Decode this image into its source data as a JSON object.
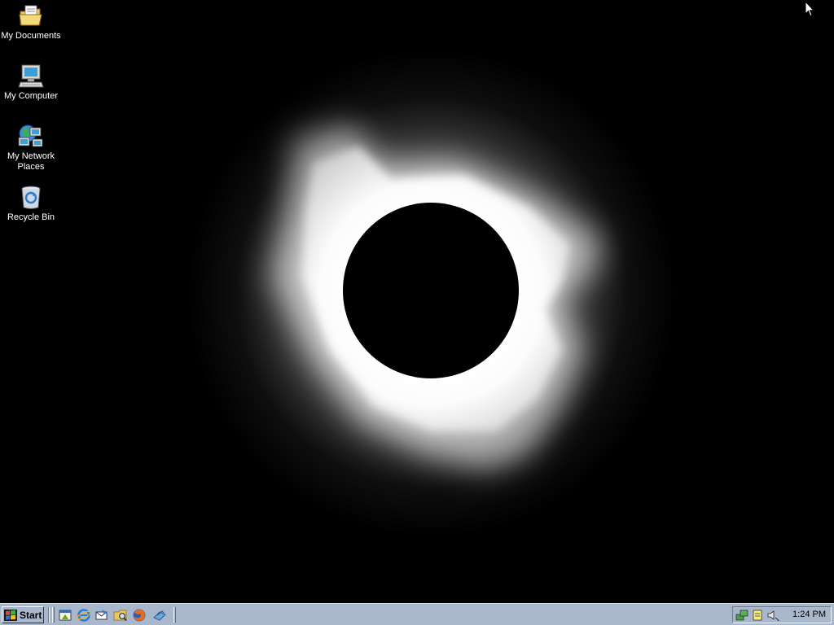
{
  "desktop": {
    "icons": [
      {
        "label": "My Documents",
        "icon": "my-documents-folder-icon"
      },
      {
        "label": "My Computer",
        "icon": "my-computer-icon"
      },
      {
        "label": "My Network Places",
        "icon": "network-places-icon"
      },
      {
        "label": "Recycle Bin",
        "icon": "recycle-bin-icon"
      }
    ],
    "wallpaper": "solar-eclipse"
  },
  "taskbar": {
    "start_label": "Start",
    "quick_launch": [
      {
        "icon": "show-desktop-icon"
      },
      {
        "icon": "internet-explorer-icon"
      },
      {
        "icon": "outlook-express-icon"
      },
      {
        "icon": "windows-explorer-icon"
      },
      {
        "icon": "firefox-icon"
      },
      {
        "icon": "winscp-icon"
      }
    ],
    "tray": {
      "icons": [
        {
          "icon": "network-connection-icon"
        },
        {
          "icon": "notepad-tray-icon"
        },
        {
          "icon": "volume-icon"
        }
      ],
      "clock": "1:24 PM"
    }
  },
  "colors": {
    "taskbar": "#a9b7cc",
    "desktop_background": "#000000",
    "icon_label": "#ffffff"
  }
}
